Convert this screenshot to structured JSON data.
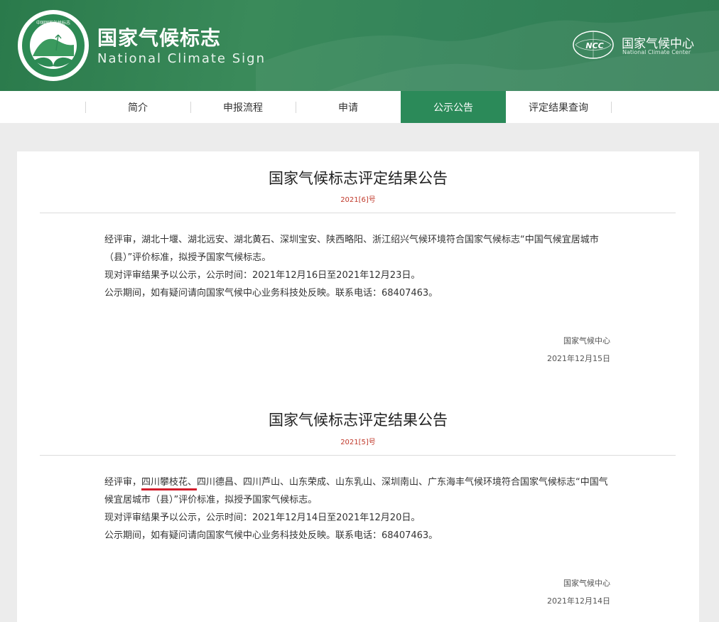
{
  "header": {
    "title_cn": "国家气候标志",
    "title_en": "National Climate Sign",
    "logo_text": "中国国家气候标志",
    "org_cn": "国家气候中心",
    "org_en": "National Climate Center",
    "org_logo_text": "NCC"
  },
  "nav": {
    "items": [
      {
        "label": "简介"
      },
      {
        "label": "申报流程"
      },
      {
        "label": "申请"
      },
      {
        "label": "公示公告"
      },
      {
        "label": "评定结果查询"
      }
    ],
    "active": "公示公告"
  },
  "notices": [
    {
      "title": "国家气候标志评定结果公告",
      "number": "2021[6]号",
      "para1": "经评审，湖北十堰、湖北远安、湖北黄石、深圳宝安、陕西略阳、浙江绍兴气候环境符合国家气候标志“中国气候宜居城市（县）”评价标准，拟授予国家气候标志。",
      "para2": "现对评审结果予以公示，公示时间：2021年12月16日至2021年12月23日。",
      "para3": "公示期间，如有疑问请向国家气候中心业务科技处反映。联系电话：68407463。",
      "signer": "国家气候中心",
      "date": "2021年12月15日"
    },
    {
      "title": "国家气候标志评定结果公告",
      "number": "2021[5]号",
      "para1_prefix": "经评审，",
      "para1_highlight": "四川攀枝花、",
      "para1_suffix": "四川德昌、四川芦山、山东荣成、山东乳山、深圳南山、广东海丰气候环境符合国家气候标志“中国气候宜居城市（县）”评价标准，拟授予国家气候标志。",
      "para2": "现对评审结果予以公示，公示时间：2021年12月14日至2021年12月20日。",
      "para3": "公示期间，如有疑问请向国家气候中心业务科技处反映。联系电话：68407463。",
      "signer": "国家气候中心",
      "date": "2021年12月14日"
    }
  ],
  "colors": {
    "brand_green": "#2b8a59",
    "header_green": "#3a8a5a",
    "number_red": "#c0392b",
    "highlight_underline": "#d21d2c"
  }
}
